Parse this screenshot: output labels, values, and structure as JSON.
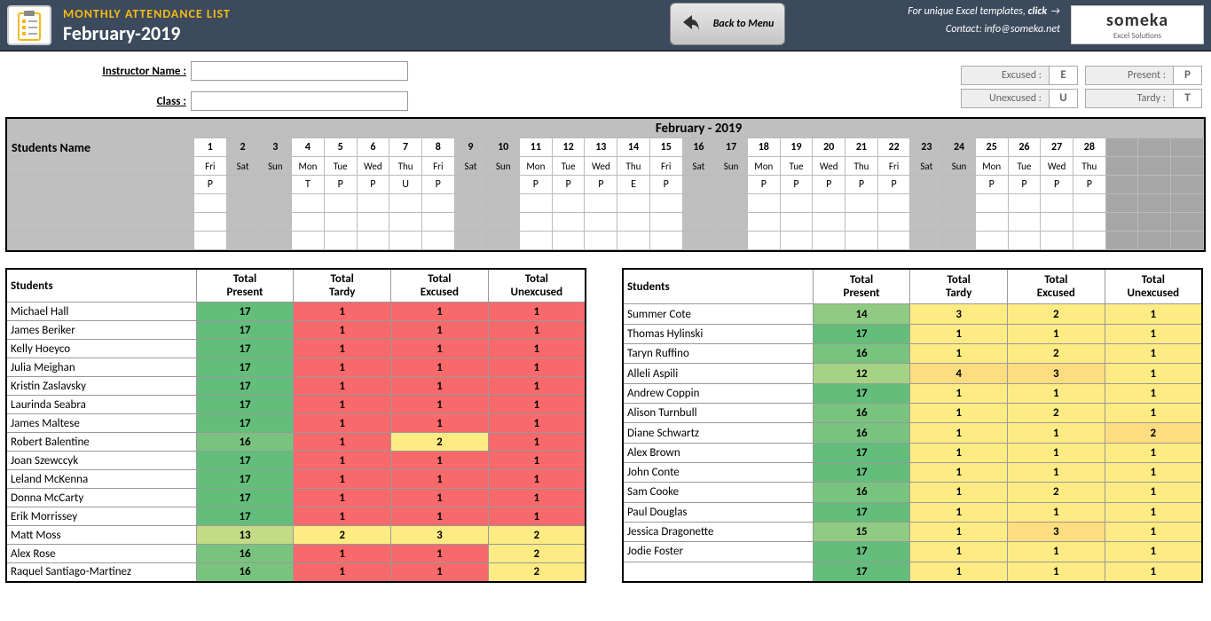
{
  "header": {
    "title": "MONTHLY ATTENDANCE LIST",
    "subtitle": "February-2019",
    "back_label": "Back to Menu",
    "promo": "For unique Excel templates,",
    "promo_bold": "click",
    "contact_label": "Contact:",
    "contact_email": "info@someka.net",
    "logo_big": "someka",
    "logo_small": "Excel Solutions"
  },
  "form": {
    "instructor_label": "Instructor Name :",
    "class_label": "Class :"
  },
  "legend": {
    "excused_l": "Excused :",
    "excused_v": "E",
    "present_l": "Present :",
    "present_v": "P",
    "unexcused_l": "Unexcused :",
    "unexcused_v": "U",
    "tardy_l": "Tardy :",
    "tardy_v": "T"
  },
  "calendar": {
    "month_label": "February - 2019",
    "students_name_label": "Students Name",
    "days": [
      {
        "n": "1",
        "d": "Fri",
        "w": false
      },
      {
        "n": "2",
        "d": "Sat",
        "w": true
      },
      {
        "n": "3",
        "d": "Sun",
        "w": true
      },
      {
        "n": "4",
        "d": "Mon",
        "w": false
      },
      {
        "n": "5",
        "d": "Tue",
        "w": false
      },
      {
        "n": "6",
        "d": "Wed",
        "w": false
      },
      {
        "n": "7",
        "d": "Thu",
        "w": false
      },
      {
        "n": "8",
        "d": "Fri",
        "w": false
      },
      {
        "n": "9",
        "d": "Sat",
        "w": true
      },
      {
        "n": "10",
        "d": "Sun",
        "w": true
      },
      {
        "n": "11",
        "d": "Mon",
        "w": false
      },
      {
        "n": "12",
        "d": "Tue",
        "w": false
      },
      {
        "n": "13",
        "d": "Wed",
        "w": false
      },
      {
        "n": "14",
        "d": "Thu",
        "w": false
      },
      {
        "n": "15",
        "d": "Fri",
        "w": false
      },
      {
        "n": "16",
        "d": "Sat",
        "w": true
      },
      {
        "n": "17",
        "d": "Sun",
        "w": true
      },
      {
        "n": "18",
        "d": "Mon",
        "w": false
      },
      {
        "n": "19",
        "d": "Tue",
        "w": false
      },
      {
        "n": "20",
        "d": "Wed",
        "w": false
      },
      {
        "n": "21",
        "d": "Thu",
        "w": false
      },
      {
        "n": "22",
        "d": "Fri",
        "w": false
      },
      {
        "n": "23",
        "d": "Sat",
        "w": true
      },
      {
        "n": "24",
        "d": "Sun",
        "w": true
      },
      {
        "n": "25",
        "d": "Mon",
        "w": false
      },
      {
        "n": "26",
        "d": "Tue",
        "w": false
      },
      {
        "n": "27",
        "d": "Wed",
        "w": false
      },
      {
        "n": "28",
        "d": "Thu",
        "w": false
      }
    ],
    "row1": [
      "P",
      "",
      "",
      "T",
      "P",
      "P",
      "U",
      "P",
      "",
      "",
      "P",
      "P",
      "P",
      "E",
      "P",
      "",
      "",
      "P",
      "P",
      "P",
      "P",
      "P",
      "",
      "",
      "P",
      "P",
      "P",
      "P"
    ]
  },
  "summary": {
    "h_students": "Students",
    "h_present": "Total Present",
    "h_tardy": "Total Tardy",
    "h_excused": "Total Excused",
    "h_unexcused": "Total Unexcused",
    "left": [
      {
        "name": "Michael Hall",
        "p": "17",
        "pc": "g1",
        "t": "1",
        "tc": "r1",
        "e": "1",
        "ec": "r1",
        "u": "1",
        "uc": "r1"
      },
      {
        "name": "James Beriker",
        "p": "17",
        "pc": "g1",
        "t": "1",
        "tc": "r1",
        "e": "1",
        "ec": "r1",
        "u": "1",
        "uc": "r1"
      },
      {
        "name": "Kelly Hoeyco",
        "p": "17",
        "pc": "g1",
        "t": "1",
        "tc": "r1",
        "e": "1",
        "ec": "r1",
        "u": "1",
        "uc": "r1"
      },
      {
        "name": "Julia Meighan",
        "p": "17",
        "pc": "g1",
        "t": "1",
        "tc": "r1",
        "e": "1",
        "ec": "r1",
        "u": "1",
        "uc": "r1"
      },
      {
        "name": "Kristin Zaslavsky",
        "p": "17",
        "pc": "g1",
        "t": "1",
        "tc": "r1",
        "e": "1",
        "ec": "r1",
        "u": "1",
        "uc": "r1"
      },
      {
        "name": "Laurinda Seabra",
        "p": "17",
        "pc": "g1",
        "t": "1",
        "tc": "r1",
        "e": "1",
        "ec": "r1",
        "u": "1",
        "uc": "r1"
      },
      {
        "name": "James Maltese",
        "p": "17",
        "pc": "g1",
        "t": "1",
        "tc": "r1",
        "e": "1",
        "ec": "r1",
        "u": "1",
        "uc": "r1"
      },
      {
        "name": "Robert Balentine",
        "p": "16",
        "pc": "g2",
        "t": "1",
        "tc": "r1",
        "e": "2",
        "ec": "y1",
        "u": "1",
        "uc": "r1"
      },
      {
        "name": "Joan Szewccyk",
        "p": "17",
        "pc": "g1",
        "t": "1",
        "tc": "r1",
        "e": "1",
        "ec": "r1",
        "u": "1",
        "uc": "r1"
      },
      {
        "name": "Leland McKenna",
        "p": "17",
        "pc": "g1",
        "t": "1",
        "tc": "r1",
        "e": "1",
        "ec": "r1",
        "u": "1",
        "uc": "r1"
      },
      {
        "name": "Donna McCarty",
        "p": "17",
        "pc": "g1",
        "t": "1",
        "tc": "r1",
        "e": "1",
        "ec": "r1",
        "u": "1",
        "uc": "r1"
      },
      {
        "name": "Erik Morrissey",
        "p": "17",
        "pc": "g1",
        "t": "1",
        "tc": "r1",
        "e": "1",
        "ec": "r1",
        "u": "1",
        "uc": "r1"
      },
      {
        "name": "Matt Moss",
        "p": "13",
        "pc": "g5",
        "t": "2",
        "tc": "y1",
        "e": "3",
        "ec": "y1",
        "u": "2",
        "uc": "y1"
      },
      {
        "name": "Alex Rose",
        "p": "16",
        "pc": "g2",
        "t": "1",
        "tc": "r1",
        "e": "1",
        "ec": "r1",
        "u": "2",
        "uc": "y1"
      },
      {
        "name": "Raquel Santiago-Martinez",
        "p": "16",
        "pc": "g2",
        "t": "1",
        "tc": "r1",
        "e": "1",
        "ec": "r1",
        "u": "2",
        "uc": "y1"
      }
    ],
    "right": [
      {
        "name": "Summer Cote",
        "p": "14",
        "pc": "g3",
        "t": "3",
        "tc": "y1",
        "e": "2",
        "ec": "y1",
        "u": "1",
        "uc": "y1"
      },
      {
        "name": "Thomas Hylinski",
        "p": "17",
        "pc": "g1",
        "t": "1",
        "tc": "y1",
        "e": "1",
        "ec": "y1",
        "u": "1",
        "uc": "y1"
      },
      {
        "name": "Taryn Ruffino",
        "p": "16",
        "pc": "g2",
        "t": "1",
        "tc": "y1",
        "e": "2",
        "ec": "y1",
        "u": "1",
        "uc": "y1"
      },
      {
        "name": "Alleli Aspili",
        "p": "12",
        "pc": "g4",
        "t": "4",
        "tc": "y2",
        "e": "3",
        "ec": "y2",
        "u": "1",
        "uc": "y1"
      },
      {
        "name": "Andrew Coppin",
        "p": "17",
        "pc": "g1",
        "t": "1",
        "tc": "y1",
        "e": "1",
        "ec": "y1",
        "u": "1",
        "uc": "y1"
      },
      {
        "name": "Alison Turnbull",
        "p": "16",
        "pc": "g2",
        "t": "1",
        "tc": "y1",
        "e": "2",
        "ec": "y1",
        "u": "1",
        "uc": "y1"
      },
      {
        "name": "Diane Schwartz",
        "p": "16",
        "pc": "g2",
        "t": "1",
        "tc": "y1",
        "e": "1",
        "ec": "y1",
        "u": "2",
        "uc": "y2"
      },
      {
        "name": "Alex Brown",
        "p": "17",
        "pc": "g1",
        "t": "1",
        "tc": "y1",
        "e": "1",
        "ec": "y1",
        "u": "1",
        "uc": "y1"
      },
      {
        "name": "John Conte",
        "p": "17",
        "pc": "g1",
        "t": "1",
        "tc": "y1",
        "e": "1",
        "ec": "y1",
        "u": "1",
        "uc": "y1"
      },
      {
        "name": "Sam Cooke",
        "p": "16",
        "pc": "g2",
        "t": "1",
        "tc": "y1",
        "e": "2",
        "ec": "y1",
        "u": "1",
        "uc": "y1"
      },
      {
        "name": "Paul Douglas",
        "p": "17",
        "pc": "g1",
        "t": "1",
        "tc": "y1",
        "e": "1",
        "ec": "y1",
        "u": "1",
        "uc": "y1"
      },
      {
        "name": "Jessica Dragonette",
        "p": "15",
        "pc": "g3",
        "t": "1",
        "tc": "y1",
        "e": "3",
        "ec": "y2",
        "u": "1",
        "uc": "y1"
      },
      {
        "name": "Jodie Foster",
        "p": "17",
        "pc": "g1",
        "t": "1",
        "tc": "y1",
        "e": "1",
        "ec": "y1",
        "u": "1",
        "uc": "y1"
      },
      {
        "name": "",
        "p": "17",
        "pc": "g1",
        "t": "1",
        "tc": "y1",
        "e": "1",
        "ec": "y1",
        "u": "1",
        "uc": "y1"
      }
    ]
  }
}
